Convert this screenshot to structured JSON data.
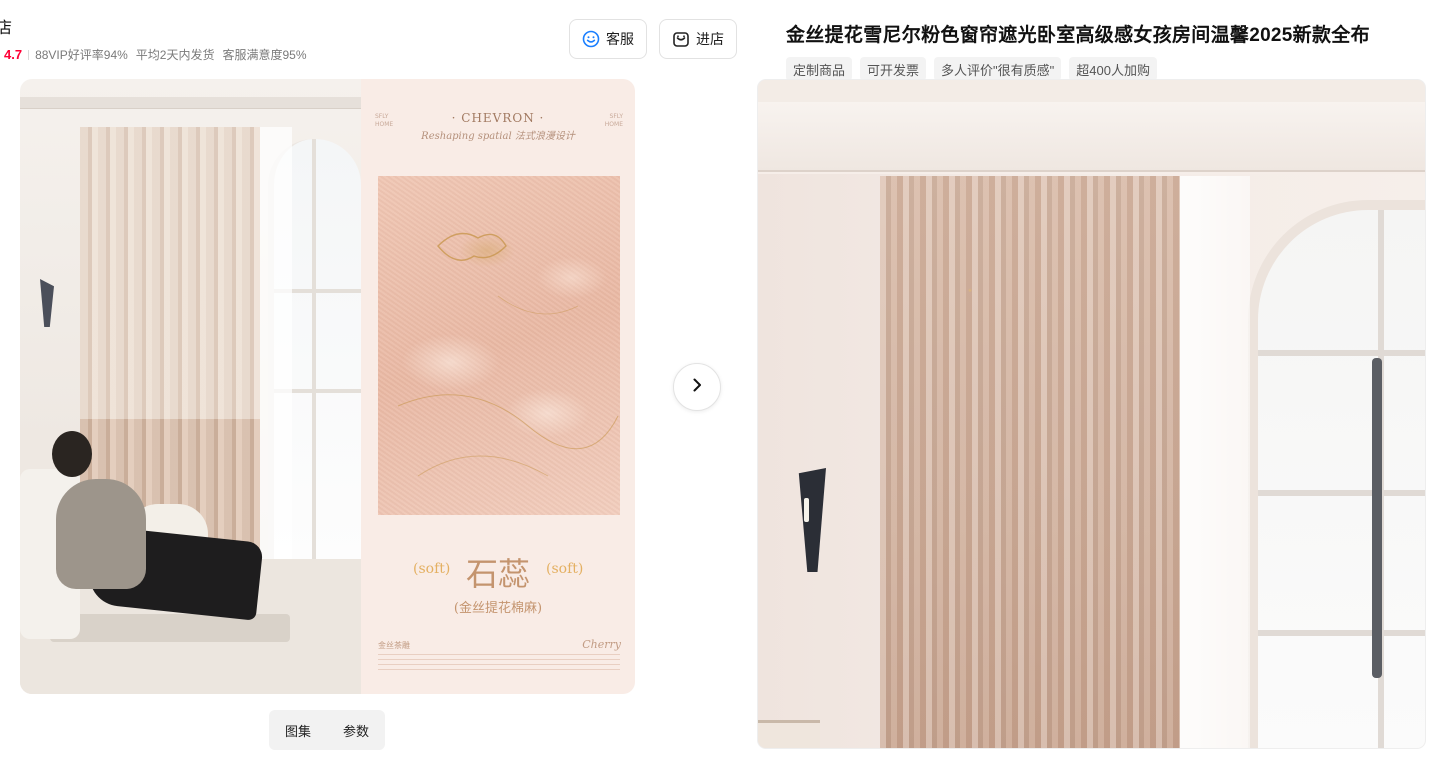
{
  "shop": {
    "name": "店",
    "rating": "4.7",
    "stats": [
      "88VIP好评率94%",
      "平均2天内发货",
      "客服满意度95%"
    ],
    "buttons": {
      "service_label": "客服",
      "enter_label": "进店"
    }
  },
  "gallery": {
    "spec_card": {
      "brand_left": "SFLY\nHOME",
      "brand_right": "SFLY\nHOME",
      "title": "· CHEVRON ·",
      "subtitle": "Reshaping spatial 法式浪漫设计",
      "soft_left": "(soft)",
      "soft_right": "(soft)",
      "color_name": "石蕊",
      "material": "(金丝提花棉麻)",
      "footer_left": "金丝茶雕",
      "footer_right": "Cherry"
    },
    "view_tabs": [
      "图集",
      "参数"
    ]
  },
  "product": {
    "title": "金丝提花雪尼尔粉色窗帘遮光卧室高级感女孩房间温馨2025新款全布",
    "tags": [
      "定制商品",
      "可开发票",
      "多人评价\"很有质感\"",
      "超400人加购"
    ]
  },
  "colors": {
    "rating_red": "#ff0036",
    "tag_bg": "#f3f3f3",
    "spec_gold": "#e4b062",
    "spec_text": "#c4946e"
  },
  "icons": {
    "service": "headset-smile-icon",
    "enter": "shop-bag-icon",
    "next": "chevron-right-icon"
  }
}
